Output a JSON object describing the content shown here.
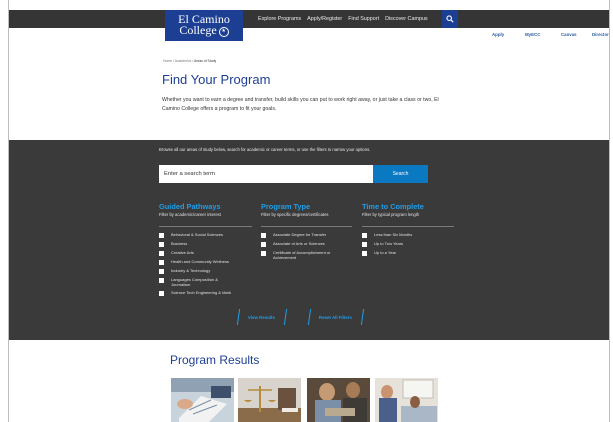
{
  "header": {
    "logo": {
      "line1": "El Camino",
      "line2": "College",
      "seal_glyph": "★"
    },
    "nav": [
      "Explore Programs",
      "Apply/Register",
      "Find Support",
      "Discover Campus"
    ],
    "search_icon": "search-icon"
  },
  "utility_nav": [
    "Apply",
    "MyECC",
    "Canvas",
    "Directory"
  ],
  "breadcrumb": {
    "items": [
      "Home",
      "Academics"
    ],
    "separator": "/",
    "current": "Areas of Study"
  },
  "page": {
    "title": "Find Your Program",
    "intro": "Whether you want to earn a degree and transfer, build skills you can put to work right away, or just take a class or two, El Camino College offers a program to fit your goals."
  },
  "filters": {
    "browse_text": "Browse all our areas of study below, search for academic or career terms, or use the filters to narrow your options.",
    "search": {
      "placeholder": "Enter a search term",
      "button": "Search"
    },
    "columns": [
      {
        "title": "Guided Pathways",
        "subtitle": "Filter by academic/career interest",
        "options": [
          "Behavioral & Social Sciences",
          "Business",
          "Creative Arts",
          "Health and Community Wellness",
          "Industry & Technology",
          "Languages Composition & Journalism",
          "Science Tech Engineering & Math"
        ]
      },
      {
        "title": "Program Type",
        "subtitle": "Filter by specific degrees/certificates",
        "options": [
          "Associate Degree for Transfer",
          "Associate of Arts or Sciences",
          "Certificate of Accomplishment or Achievement"
        ]
      },
      {
        "title": "Time to Complete",
        "subtitle": "Filter by typical program length",
        "options": [
          "Less than Six Months",
          "Up to Two Years",
          "Up to a Year"
        ]
      }
    ],
    "actions": {
      "view": "View Results",
      "reset": "Reset All Filters"
    }
  },
  "results": {
    "title": "Program Results"
  },
  "colors": {
    "brand_blue": "#1d3f93",
    "accent_blue": "#1f9de8",
    "button_blue": "#0b78c2",
    "dark_panel": "#3a3a3a",
    "top_bar": "#353535"
  }
}
